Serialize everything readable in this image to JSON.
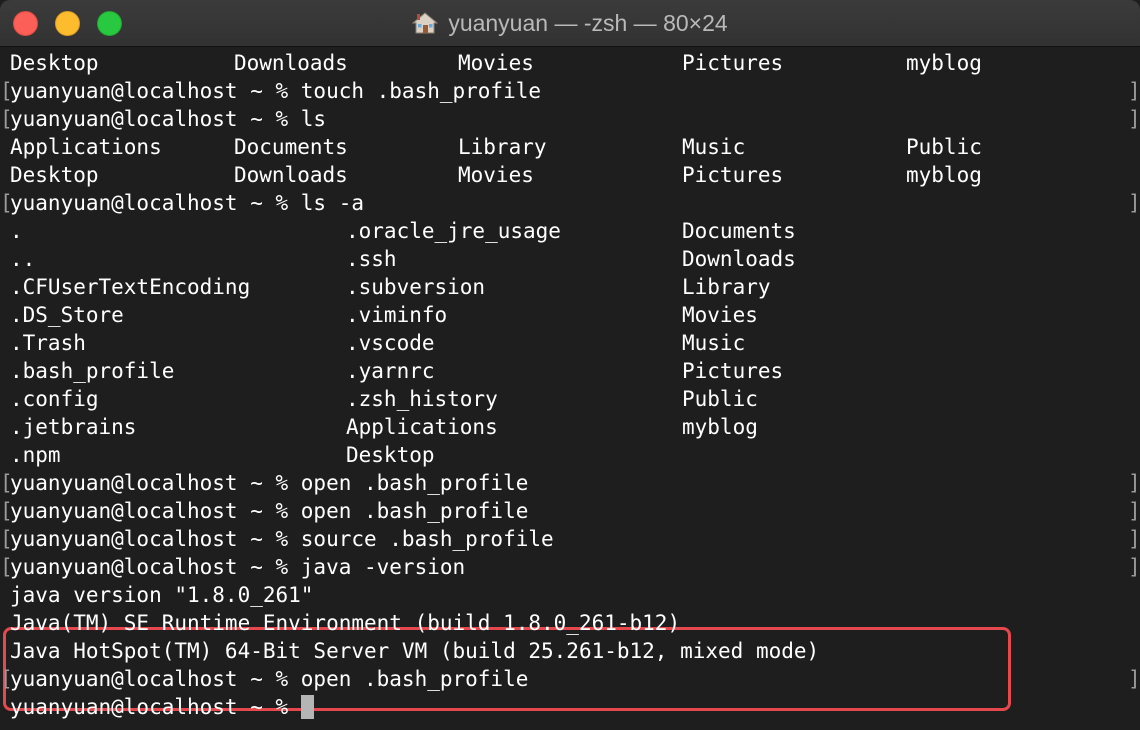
{
  "window": {
    "title": "yuanyuan — -zsh — 80×24",
    "title_icon": "home-icon"
  },
  "colors": {
    "background": "#1e1e1e",
    "text": "#ffffff",
    "highlight_border": "#e5484d",
    "cursor": "#b5b5b5"
  },
  "terminal": {
    "lines": [
      {
        "type": "cols5",
        "cols": [
          "Desktop",
          "Downloads",
          "Movies",
          "Pictures",
          "myblog"
        ]
      },
      {
        "type": "prompt",
        "text": "yuanyuan@localhost ~ % touch .bash_profile"
      },
      {
        "type": "prompt",
        "text": "yuanyuan@localhost ~ % ls"
      },
      {
        "type": "cols5",
        "cols": [
          "Applications",
          "Documents",
          "Library",
          "Music",
          "Public"
        ]
      },
      {
        "type": "cols5",
        "cols": [
          "Desktop",
          "Downloads",
          "Movies",
          "Pictures",
          "myblog"
        ]
      },
      {
        "type": "prompt",
        "text": "yuanyuan@localhost ~ % ls -a"
      },
      {
        "type": "cols3",
        "cols": [
          ".",
          ".oracle_jre_usage",
          "Documents"
        ]
      },
      {
        "type": "cols3",
        "cols": [
          "..",
          ".ssh",
          "Downloads"
        ]
      },
      {
        "type": "cols3",
        "cols": [
          ".CFUserTextEncoding",
          ".subversion",
          "Library"
        ]
      },
      {
        "type": "cols3",
        "cols": [
          ".DS_Store",
          ".viminfo",
          "Movies"
        ]
      },
      {
        "type": "cols3",
        "cols": [
          ".Trash",
          ".vscode",
          "Music"
        ]
      },
      {
        "type": "cols3",
        "cols": [
          ".bash_profile",
          ".yarnrc",
          "Pictures"
        ]
      },
      {
        "type": "cols3",
        "cols": [
          ".config",
          ".zsh_history",
          "Public"
        ]
      },
      {
        "type": "cols3",
        "cols": [
          ".jetbrains",
          "Applications",
          "myblog"
        ]
      },
      {
        "type": "cols3",
        "cols": [
          ".npm",
          "Desktop",
          ""
        ]
      },
      {
        "type": "prompt",
        "text": "yuanyuan@localhost ~ % open .bash_profile"
      },
      {
        "type": "prompt",
        "text": "yuanyuan@localhost ~ % open .bash_profile"
      },
      {
        "type": "prompt",
        "text": "yuanyuan@localhost ~ % source .bash_profile"
      },
      {
        "type": "prompt",
        "text": "yuanyuan@localhost ~ % java -version"
      },
      {
        "type": "output",
        "text": "java version \"1.8.0_261\""
      },
      {
        "type": "output",
        "text": "Java(TM) SE Runtime Environment (build 1.8.0_261-b12)"
      },
      {
        "type": "output",
        "text": "Java HotSpot(TM) 64-Bit Server VM (build 25.261-b12, mixed mode)"
      },
      {
        "type": "prompt",
        "text": "yuanyuan@localhost ~ % open .bash_profile"
      },
      {
        "type": "current",
        "text": "yuanyuan@localhost ~ % "
      }
    ]
  }
}
